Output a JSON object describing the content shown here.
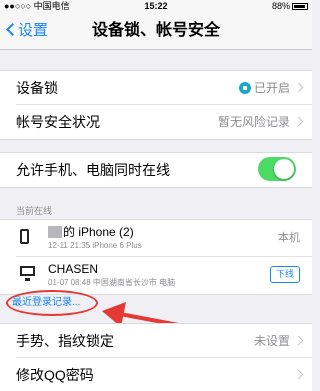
{
  "status_bar": {
    "carrier": "●●○○○ 中国电信",
    "time": "15:22",
    "battery": "88%"
  },
  "nav": {
    "back_label": "设置",
    "title": "设备锁、帐号安全"
  },
  "security": {
    "device_lock_label": "设备锁",
    "device_lock_value": "已开启",
    "account_status_label": "帐号安全状况",
    "account_status_value": "暂无风险记录"
  },
  "online_toggle": {
    "label": "允许手机、电脑同时在线",
    "on": true
  },
  "online_section": {
    "header": "当前在线",
    "devices": [
      {
        "name": "的 iPhone (2)",
        "meta": "12-11 21:35  iPhone 6 Plus",
        "status": "本机",
        "icon": "phone-icon"
      },
      {
        "name": "CHASEN",
        "meta": "01-07 08:48  中国湖南省长沙市 电脑",
        "action": "下线",
        "icon": "computer-icon"
      }
    ],
    "recent_link": "最近登录记录..."
  },
  "more": {
    "gesture_label": "手势、指纹锁定",
    "gesture_value": "未设置",
    "password_label": "修改QQ密码"
  },
  "colors": {
    "accent": "#1a87f2",
    "toggle_on": "#4cd964",
    "annotation": "#e53935"
  }
}
